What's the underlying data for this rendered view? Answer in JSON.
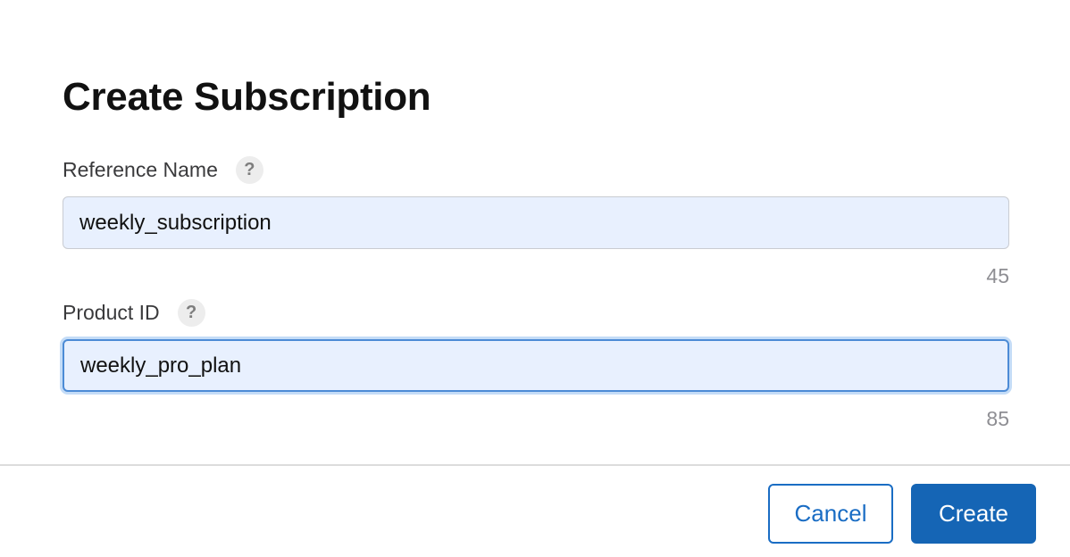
{
  "dialog": {
    "title": "Create Subscription"
  },
  "fields": {
    "reference_name": {
      "label": "Reference Name",
      "help": "?",
      "value": "weekly_subscription",
      "remaining": "45"
    },
    "product_id": {
      "label": "Product ID",
      "help": "?",
      "value": "weekly_pro_plan",
      "remaining": "85"
    }
  },
  "actions": {
    "cancel_label": "Cancel",
    "create_label": "Create"
  },
  "colors": {
    "accent": "#1565b5",
    "input_bg": "#e8f0fe",
    "focus_ring": "#c4dcf7"
  }
}
